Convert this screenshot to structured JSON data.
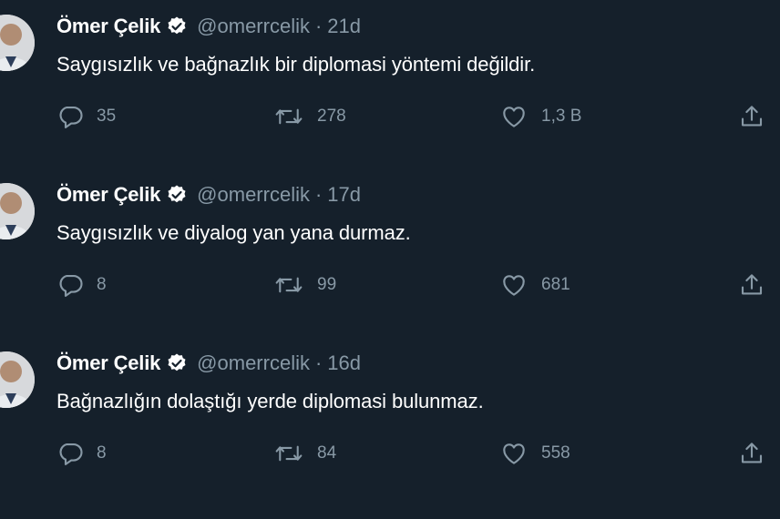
{
  "tweets": [
    {
      "name": "Ömer Çelik",
      "handle": "@omerrcelik",
      "separator": "·",
      "time": "21d",
      "text": "Saygısızlık ve bağnazlık bir diplomasi yöntemi değildir.",
      "replies": "35",
      "retweets": "278",
      "likes": "1,3 B"
    },
    {
      "name": "Ömer Çelik",
      "handle": "@omerrcelik",
      "separator": "·",
      "time": "17d",
      "text": "Saygısızlık ve diyalog yan yana durmaz.",
      "replies": "8",
      "retweets": "99",
      "likes": "681"
    },
    {
      "name": "Ömer Çelik",
      "handle": "@omerrcelik",
      "separator": "·",
      "time": "16d",
      "text": "Bağnazlığın dolaştığı yerde diplomasi bulunmaz.",
      "replies": "8",
      "retweets": "84",
      "likes": "558"
    }
  ],
  "icons": {
    "verified": "verified-badge-icon",
    "reply": "reply-icon",
    "retweet": "retweet-icon",
    "like": "heart-icon",
    "share": "share-icon"
  },
  "colors": {
    "background": "#15202b",
    "primary_text": "#ffffff",
    "secondary_text": "#8899a6"
  }
}
